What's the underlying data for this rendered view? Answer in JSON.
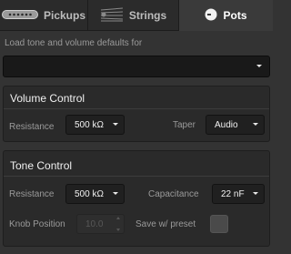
{
  "tabs": [
    {
      "label": "Pickups",
      "icon": "pickup-icon",
      "active": false
    },
    {
      "label": "Strings",
      "icon": "strings-icon",
      "active": false
    },
    {
      "label": "Pots",
      "icon": "knob-icon",
      "active": true
    }
  ],
  "defaults": {
    "label": "Load tone and volume defaults for",
    "selected": ""
  },
  "volume": {
    "title": "Volume Control",
    "resistance_label": "Resistance",
    "resistance_value": "500 kΩ",
    "taper_label": "Taper",
    "taper_value": "Audio"
  },
  "tone": {
    "title": "Tone Control",
    "resistance_label": "Resistance",
    "resistance_value": "500 kΩ",
    "capacitance_label": "Capacitance",
    "capacitance_value": "22 nF",
    "knob_label": "Knob Position",
    "knob_value": "10.0",
    "save_label": "Save w/ preset",
    "save_checked": false
  },
  "colors": {
    "background": "#333333",
    "panel": "#2a2a2a",
    "dropdown": "#202020",
    "active_tab": "#3a3a3a",
    "label_text": "#9a9a9a"
  }
}
